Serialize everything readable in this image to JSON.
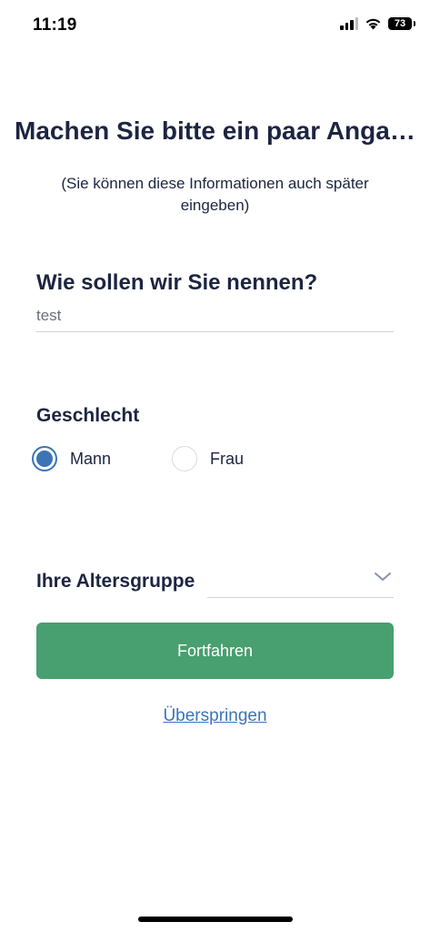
{
  "status_bar": {
    "time": "11:19",
    "battery": "73"
  },
  "header": {
    "title": "Machen Sie bitte ein paar Angaben",
    "subtitle": "(Sie können diese Informationen auch später eingeben)"
  },
  "name": {
    "label": "Wie sollen wir Sie nennen?",
    "value": "test"
  },
  "gender": {
    "label": "Geschlecht",
    "options": [
      {
        "label": "Mann",
        "selected": true
      },
      {
        "label": "Frau",
        "selected": false
      }
    ]
  },
  "age": {
    "label": "Ihre Altersgruppe",
    "value": ""
  },
  "actions": {
    "continue_label": "Fortfahren",
    "skip_label": "Überspringen"
  },
  "colors": {
    "primary_text": "#1c2541",
    "accent_blue": "#3b74b7",
    "button_green": "#489f6f"
  },
  "icons": {
    "signal": "signal-icon",
    "wifi": "wifi-icon",
    "battery": "battery-icon",
    "dropdown": "chevron-down-icon"
  }
}
